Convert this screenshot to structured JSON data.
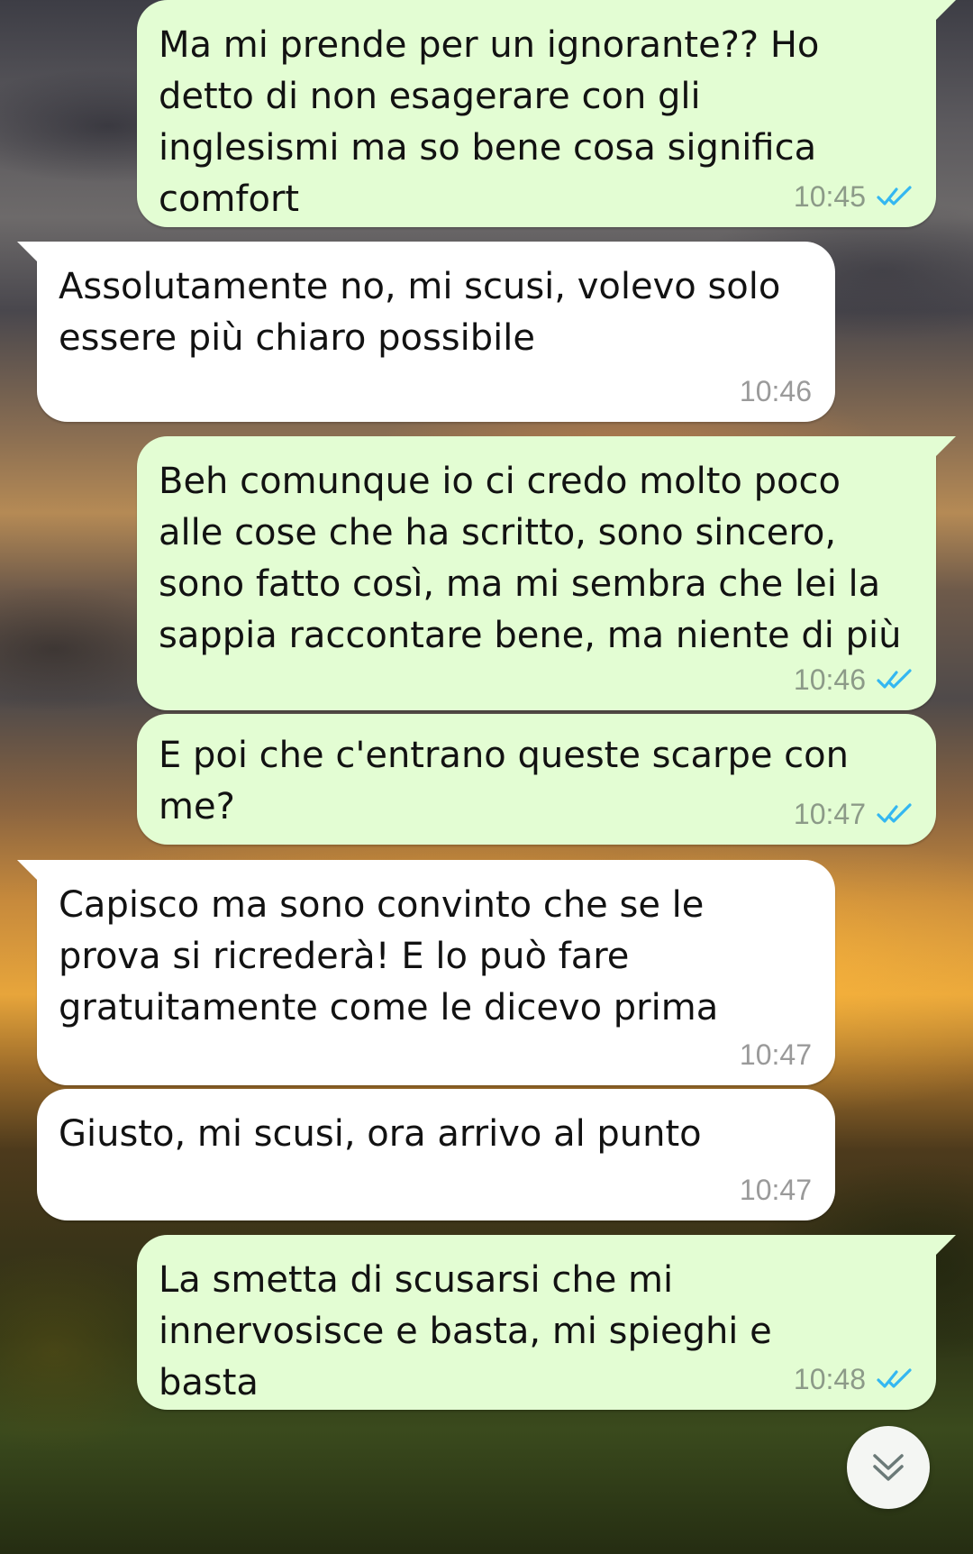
{
  "messages": [
    {
      "direction": "outgoing",
      "text": "Ma mi prende per un ignorante?? Ho detto di non esagerare con gli inglesismi ma so bene cosa significa comfort",
      "time": "10:45",
      "status": "read"
    },
    {
      "direction": "incoming",
      "text": "Assolutamente no, mi scusi, volevo solo essere più chiaro possibile",
      "time": "10:46"
    },
    {
      "direction": "outgoing",
      "text": "Beh comunque io ci credo molto poco alle cose che ha scritto, sono sincero, sono fatto così, ma mi sembra che lei la sappia raccontare bene, ma niente di più",
      "time": "10:46",
      "status": "read"
    },
    {
      "direction": "outgoing",
      "text": "E poi che c'entrano queste scarpe con me?",
      "time": "10:47",
      "status": "read"
    },
    {
      "direction": "incoming",
      "text": "Capisco ma sono convinto che se le prova si ricrederà! E lo può fare gratuitamente come le dicevo prima",
      "time": "10:47"
    },
    {
      "direction": "incoming",
      "text": "Giusto, mi scusi, ora arrivo al punto",
      "time": "10:47"
    },
    {
      "direction": "outgoing",
      "text": "La smetta di scusarsi che mi innervosisce e basta, mi spieghi e basta",
      "time": "10:48",
      "status": "read"
    }
  ],
  "icons": {
    "read_receipt": "double-check-icon",
    "scroll_down": "chevron-double-down-icon"
  },
  "colors": {
    "outgoing_bubble": "#e3fdd3",
    "incoming_bubble": "#ffffff",
    "read_tick": "#34b7f1"
  }
}
